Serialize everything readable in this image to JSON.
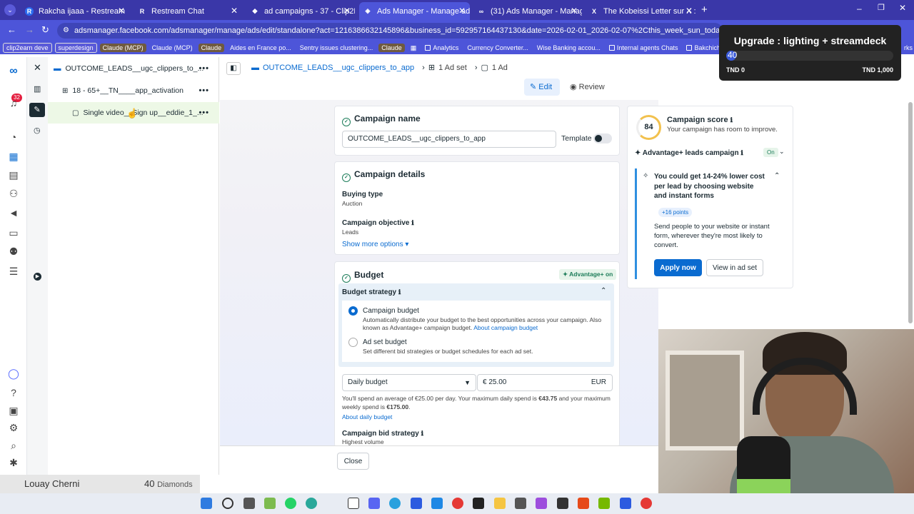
{
  "browser": {
    "tabs": [
      {
        "title": "Rakcha ijaaa - Restream",
        "fav": "R"
      },
      {
        "title": "Restream Chat",
        "fav": "R"
      },
      {
        "title": "ad campaigns - 37 - Clip2Earn",
        "fav": "◆"
      },
      {
        "title": "Ads Manager - Manage ads - A",
        "fav": "◈"
      },
      {
        "title": "(31) Ads Manager - Manage ad",
        "fav": "∞"
      },
      {
        "title": "The Kobeissi Letter sur X : \"BRE",
        "fav": "X"
      }
    ],
    "url": "adsmanager.facebook.com/adsmanager/manage/ads/edit/standalone?act=1216386632145896&business_id=592957164437130&date=2026-02-01_2026-02-07%2Cthis_week_sun_today&insights_date=2026-02-...",
    "bookmarks": [
      "clip2earn deve",
      "superdesign",
      "Claude (MCP)",
      "Claude (MCP)",
      "Claude",
      "Aides en France po...",
      "Sentry issues clustering...",
      "Claude",
      "Analytics",
      "Currency Converter...",
      "Wise Banking accou...",
      "Internal agents Chats",
      "Bakchich"
    ],
    "bookmark_tail": "rks"
  },
  "rail": {
    "notifications": "32"
  },
  "tree": {
    "campaign": "OUTCOME_LEADS__ugc_clippers_to_...",
    "adset": "18 - 65+__TN____app_activation",
    "ad": "Single video__Sign up__eddie_1_..."
  },
  "breadcrumb": {
    "campaign": "OUTCOME_LEADS__ugc_clippers_to_app",
    "adset": "1 Ad set",
    "ad": "1 Ad"
  },
  "modes": {
    "edit": "Edit",
    "review": "Review"
  },
  "campaign_name": {
    "heading": "Campaign name",
    "value": "OUTCOME_LEADS__ugc_clippers_to_app",
    "template_label": "Template"
  },
  "details": {
    "heading": "Campaign details",
    "buying_type_label": "Buying type",
    "buying_type": "Auction",
    "objective_label": "Campaign objective",
    "objective": "Leads",
    "more": "Show more options ▾"
  },
  "budget": {
    "heading": "Budget",
    "badge": "Advantage+ on",
    "strategy_label": "Budget strategy",
    "opt1_title": "Campaign budget",
    "opt1_desc": "Automatically distribute your budget to the best opportunities across your campaign. Also known as Advantage+ campaign budget.",
    "opt1_link": "About campaign budget",
    "opt2_title": "Ad set budget",
    "opt2_desc": "Set different bid strategies or budget schedules for each ad set.",
    "type": "Daily budget",
    "amount": "€ 25.00",
    "currency": "EUR",
    "note_a": "You'll spend an average of €25.00 per day. Your maximum daily spend is ",
    "note_b": "€43.75",
    "note_c": " and your maximum weekly spend is ",
    "note_d": "€175.00",
    "note_e": ".",
    "about": "About daily budget",
    "bid_label": "Campaign bid strategy",
    "bid_value": "Highest volume"
  },
  "footer": {
    "close": "Close"
  },
  "score": {
    "value": "84",
    "title": "Campaign score",
    "subtitle": "Your campaign has room to improve.",
    "advantage": "✦ Advantage+ leads campaign",
    "toggle": "On",
    "tip_title": "You could get 14-24% lower cost per lead by choosing website and instant forms",
    "points": "+16 points",
    "tip_body": "Send people to your website or instant form, wherever they're most likely to convert.",
    "apply": "Apply now",
    "view": "View in ad set"
  },
  "overlay": {
    "title": "Upgrade : lighting + streamdeck",
    "value": "40",
    "min": "TND 0",
    "max": "TND 1,000",
    "progress_fraction": 0.04
  },
  "stream": {
    "name": "Louay Cherni",
    "count": "40",
    "unit": "Diamonds"
  },
  "colors": {
    "tabbar": "#3a37a8",
    "toolbar": "#4d55d9",
    "primary": "#0a6bd0",
    "success": "#1d7d5a"
  }
}
